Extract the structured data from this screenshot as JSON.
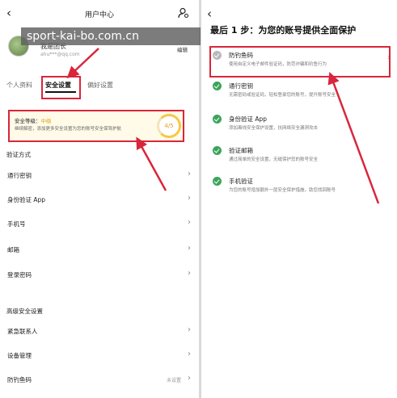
{
  "watermark": "sport-kai-bo.com.cn",
  "left": {
    "title": "用户中心",
    "back_glyph": "‹",
    "user": {
      "nickname": "我是团长",
      "email": "ahu***@qq.com",
      "edit": "编辑"
    },
    "tabs": [
      "个人资料",
      "安全设置",
      "偏好设置"
    ],
    "security": {
      "label": "安全等级：",
      "level": "中级",
      "desc": "继续解密，添加更多安全设置为您的账号安全保驾护航",
      "score": "4/5"
    },
    "section_verify": "验证方式",
    "verify_items": [
      "通行密钥",
      "身份验证 App",
      "手机号",
      "邮箱",
      "登录密码"
    ],
    "section_advanced": "高级安全设置",
    "advanced_items": [
      "紧急联系人",
      "设备管理",
      "防钓鱼码"
    ],
    "antiphish_value": "未设置",
    "chevron": "›"
  },
  "right": {
    "back_glyph": "‹",
    "heading": "最后 1 步：为您的账号提供全面保护",
    "steps": [
      {
        "title": "防钓鱼码",
        "desc": "使用自定义电子邮件验证码，防范诈骗和钓鱼行为",
        "done": false
      },
      {
        "title": "通行密钥",
        "desc": "无需密码或验证码，轻松登录您的账号，提升账号安全",
        "done": true
      },
      {
        "title": "身份验证 App",
        "desc": "添加离线安全保护设置，抗网络安全漏洞攻击",
        "done": true
      },
      {
        "title": "验证邮箱",
        "desc": "通过简单的安全设置，无缝保护您的账号安全",
        "done": true
      },
      {
        "title": "手机验证",
        "desc": "为您的账号增加额外一层安全保护措施，助您找回账号",
        "done": true
      }
    ],
    "chevron": "›"
  },
  "colors": {
    "accent_red": "#d9263a",
    "success_green": "#3aa55a",
    "level_orange": "#e4a31f"
  }
}
